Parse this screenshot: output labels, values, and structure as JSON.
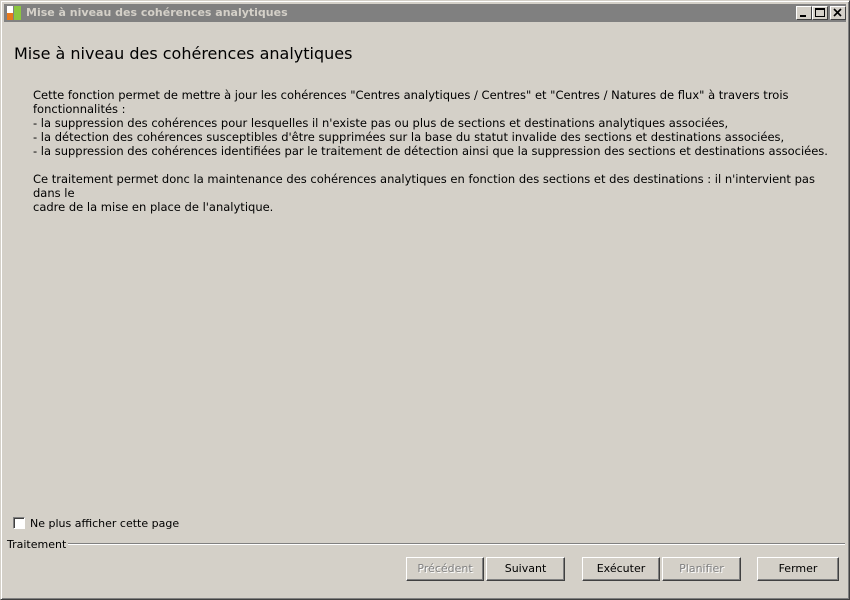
{
  "window": {
    "title": "Mise à niveau des cohérences analytiques"
  },
  "page": {
    "title": "Mise à niveau des cohérences analytiques",
    "description_lines": [
      "Cette fonction permet de mettre à jour les cohérences \"Centres analytiques / Centres\" et \"Centres / Natures de flux\" à travers trois",
      "fonctionnalités :",
      "- la suppression des cohérences pour lesquelles il n'existe pas ou plus de sections et destinations analytiques associées,",
      "- la détection des cohérences susceptibles d'être supprimées sur la base du statut invalide des sections et destinations associées,",
      "- la suppression des cohérences identifiées par le traitement de détection ainsi que la suppression des sections et destinations associées."
    ],
    "paragraph2_lines": [
      "Ce traitement permet donc la maintenance des cohérences analytiques en fonction des sections et des destinations : il n'intervient pas dans le",
      "cadre de la mise en place de l'analytique."
    ]
  },
  "options": {
    "hide_page_label": "Ne plus afficher cette page",
    "hide_page_checked": false
  },
  "treatment": {
    "group_label": "Traitement",
    "buttons": {
      "previous": "Précédent",
      "next": "Suivant",
      "execute": "Exécuter",
      "schedule": "Planifier",
      "close": "Fermer"
    }
  },
  "colors": {
    "window_bg": "#d4d0c8",
    "titlebar_inactive": "#808080",
    "disabled_text": "#808080"
  },
  "icons": {
    "app": "app-icon",
    "minimize": "minimize-icon",
    "maximize": "maximize-icon",
    "close": "close-icon"
  }
}
